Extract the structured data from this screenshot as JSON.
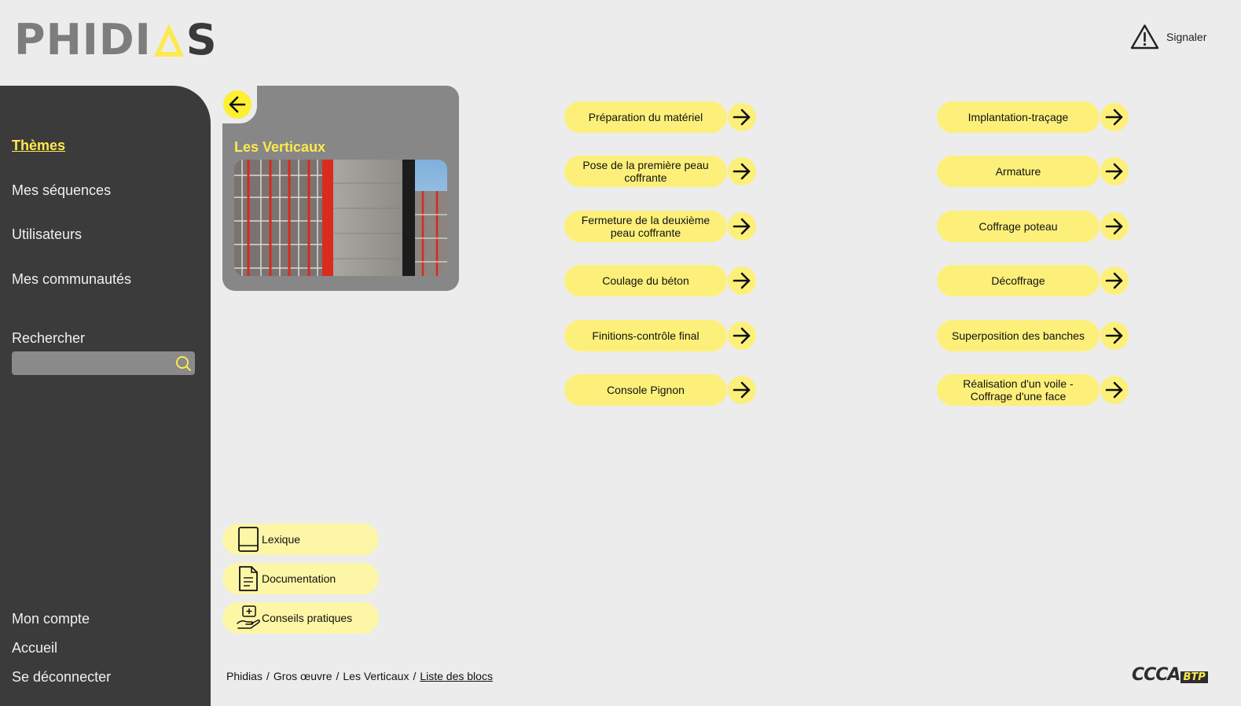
{
  "header": {
    "logo_text_left": "PHIDI",
    "logo_text_right": "S",
    "report_label": "Signaler",
    "icons": {
      "report": "warning-triangle-icon"
    }
  },
  "sidebar": {
    "items": [
      {
        "label": "Thèmes",
        "active": true
      },
      {
        "label": "Mes séquences"
      },
      {
        "label": "Utilisateurs"
      },
      {
        "label": "Mes communautés"
      }
    ],
    "search_label": "Rechercher",
    "search_value": "",
    "search_placeholder": "",
    "footer_items": [
      {
        "label": "Mon compte"
      },
      {
        "label": "Accueil"
      },
      {
        "label": "Se déconnecter"
      }
    ]
  },
  "theme": {
    "title": "Les Verticaux"
  },
  "blocks": {
    "left": [
      "Préparation du matériel",
      "Pose de la première peau coffrante",
      "Fermeture de la deuxième peau coffrante",
      "Coulage du béton",
      "Finitions-contrôle final",
      "Console Pignon"
    ],
    "right": [
      "Implantation-traçage",
      "Armature",
      "Coffrage poteau",
      "Décoffrage",
      "Superposition des banches",
      "Réalisation d'un voile - Coffrage d'une face"
    ]
  },
  "resources": [
    {
      "label": "Lexique",
      "icon": "book-icon"
    },
    {
      "label": "Documentation",
      "icon": "document-icon"
    },
    {
      "label": "Conseils pratiques",
      "icon": "hand-advice-icon"
    }
  ],
  "breadcrumb": {
    "items": [
      "Phidias",
      "Gros œuvre",
      "Les Verticaux"
    ],
    "current": "Liste des blocs",
    "separator": "/"
  },
  "footer": {
    "partner_logo_main": "CCCA",
    "partner_logo_sub": "BTP"
  },
  "colors": {
    "accent_yellow": "#fde94d",
    "pill_yellow": "#fdf07a",
    "sidebar_bg": "#3b3b3b",
    "page_bg": "#ececec",
    "card_bg": "#878787"
  }
}
